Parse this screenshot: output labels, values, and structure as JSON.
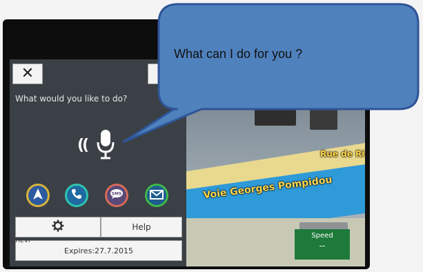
{
  "voice_panel": {
    "close_label": "✕",
    "prompt": "What would you like to do?",
    "buttons": {
      "navigate_icon": "navigation-arrow-icon",
      "phone_icon": "phone-icon",
      "sms_icon": "sms-icon",
      "sms_text": "SMS",
      "email_icon": "envelope-icon"
    },
    "settings_icon": "gear-icon",
    "help_label": "Help",
    "expires_label": "Expires:27.7.2015"
  },
  "map": {
    "street_labels": [
      "Voie Georges Pompidou",
      "Rue de Ri"
    ],
    "speed_label": "Speed",
    "speed_value": "--"
  },
  "status_bar": {
    "text": "CHEVI"
  },
  "callout": {
    "text": "What can I do for you ?"
  },
  "colors": {
    "bubble_fill": "#4f81bd",
    "bubble_stroke": "#2f5597",
    "panel_bg": "#3a4045"
  }
}
